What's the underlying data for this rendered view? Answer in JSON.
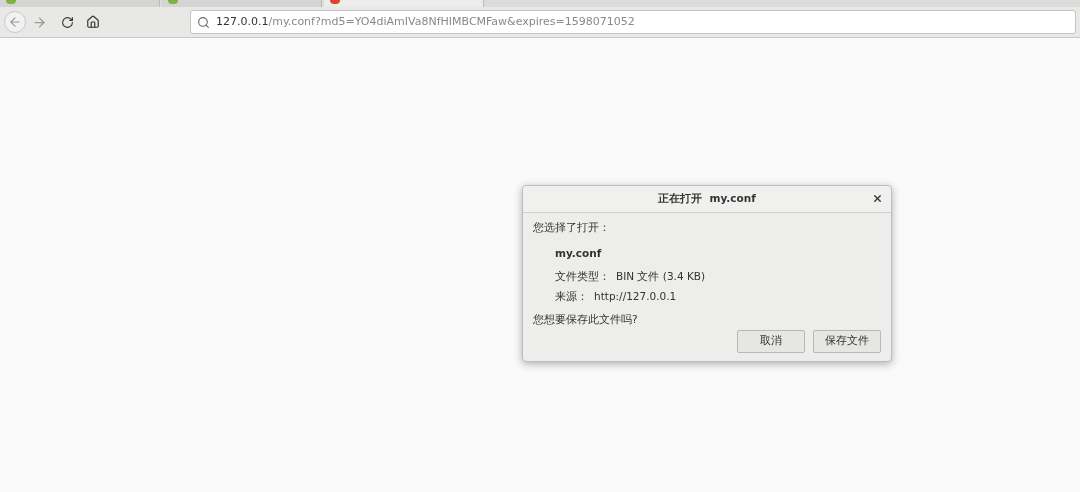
{
  "tabs": [
    {
      "selected": false
    },
    {
      "selected": false
    },
    {
      "selected": true
    }
  ],
  "address_bar": {
    "host": "127.0.0.1",
    "rest": "/my.conf?md5=YO4diAmIVa8NfHIMBCMFaw&expires=1598071052"
  },
  "dialog": {
    "title": "正在打开  my.conf",
    "intro": "您选择了打开：",
    "file_name": "my.conf",
    "file_type_label": "文件类型：",
    "file_type": "BIN 文件 (3.4 KB)",
    "source_label": "来源：",
    "source": "http://127.0.0.1",
    "question": "您想要保存此文件吗?",
    "buttons": [
      "取消",
      "保存文件"
    ]
  }
}
